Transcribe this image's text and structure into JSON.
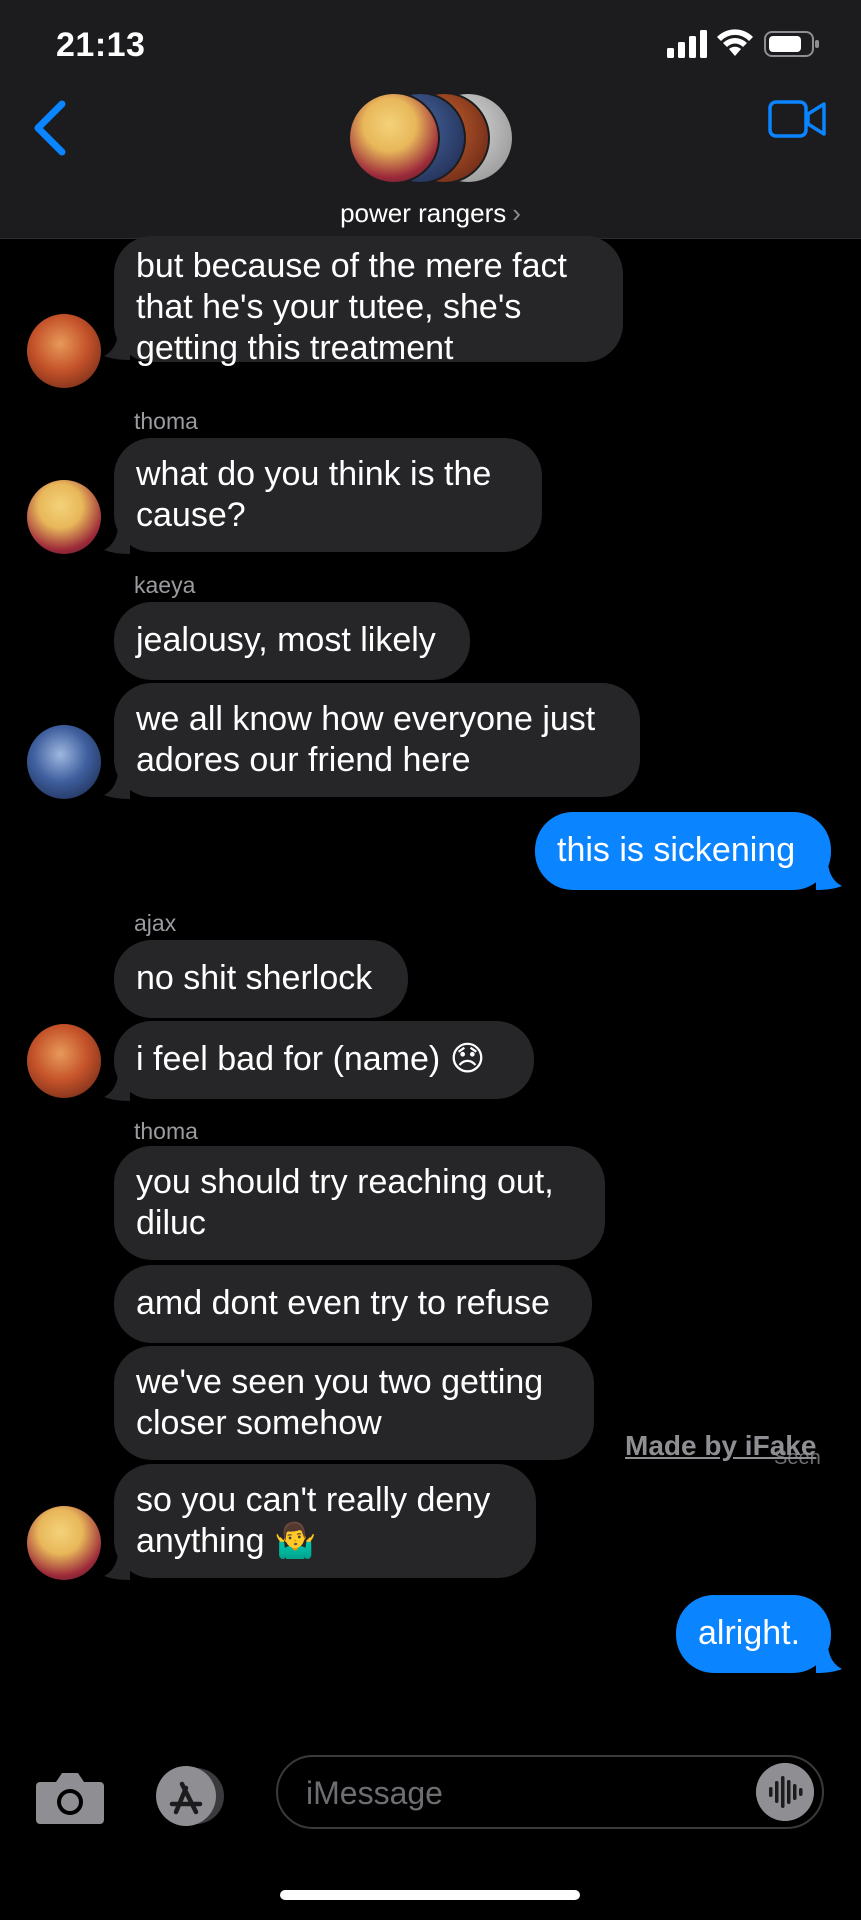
{
  "status": {
    "time": "21:13"
  },
  "header": {
    "group_name": "power rangers",
    "chevron": "›"
  },
  "messages": [
    {
      "text": "but because of the mere fact that he's your tutee, she's getting this treatment"
    },
    {
      "sender": "thoma"
    },
    {
      "text": "what do you think is the cause?"
    },
    {
      "sender": "kaeya"
    },
    {
      "text": "jealousy, most likely"
    },
    {
      "text": "we all know how everyone just adores our friend here"
    },
    {
      "text": "this is sickening"
    },
    {
      "sender": "ajax"
    },
    {
      "text": "no shit sherlock"
    },
    {
      "text": "i feel bad for (name) 😞"
    },
    {
      "sender": "thoma"
    },
    {
      "text": "you should try reaching out, diluc"
    },
    {
      "text": "amd dont even try to refuse"
    },
    {
      "text": "we've seen you two getting closer somehow"
    },
    {
      "text": "so you can't really deny anything 🤷‍♂️"
    },
    {
      "text": "alright."
    }
  ],
  "watermark": "Made by iFake",
  "seen_label": "Seen",
  "composer": {
    "placeholder": "iMessage"
  },
  "colors": {
    "accent": "#0a84ff",
    "bubble_other": "#262628",
    "header_bg": "#1c1c1e"
  }
}
